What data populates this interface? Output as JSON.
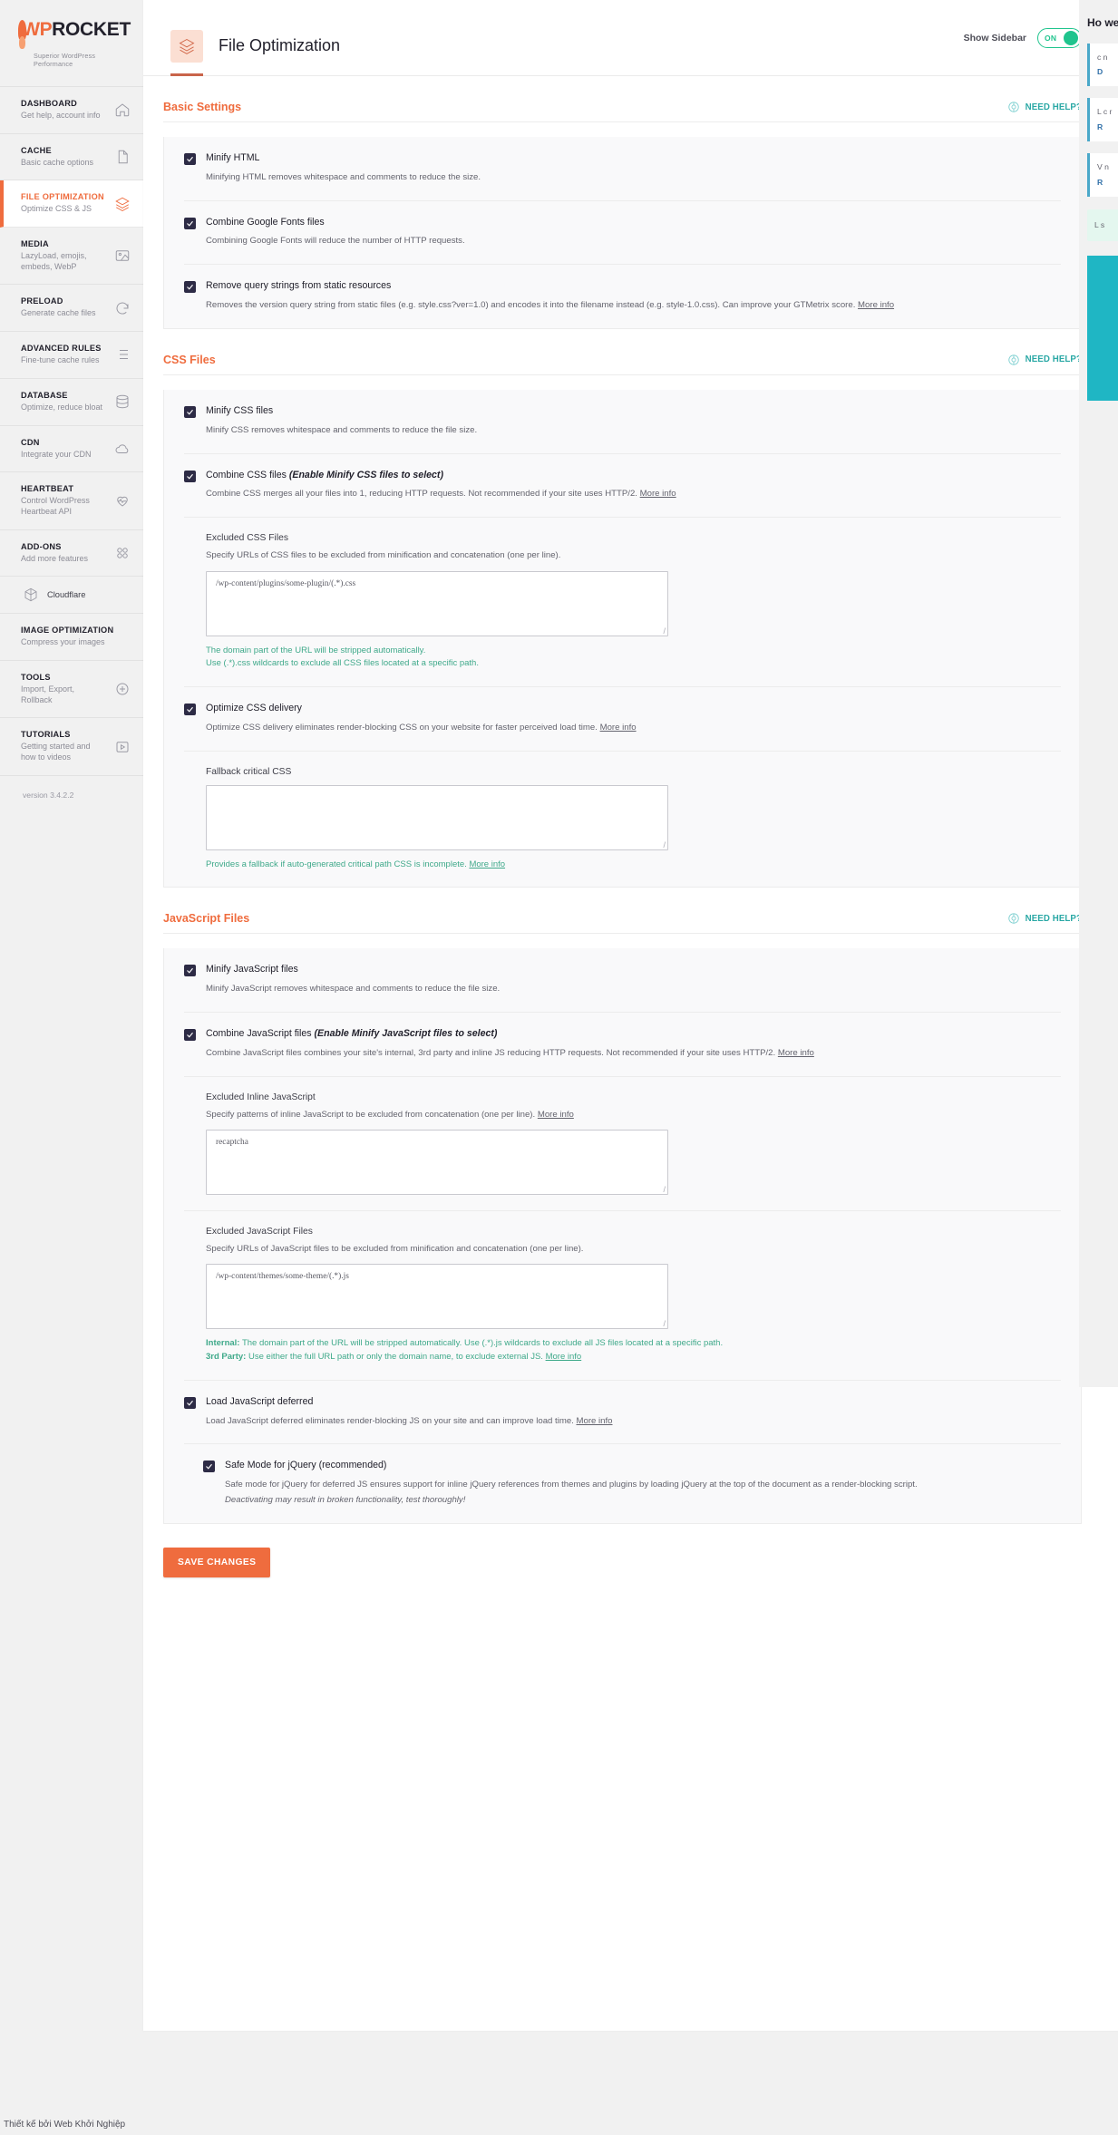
{
  "brand": {
    "name_wp": "WP",
    "name_rocket": "ROCKET",
    "tagline": "Superior WordPress Performance",
    "accent": "#ef6c3e",
    "version": "version 3.4.2.2"
  },
  "sidebar": {
    "items": [
      {
        "title": "DASHBOARD",
        "sub": "Get help, account info",
        "icon": "home-icon",
        "active": false
      },
      {
        "title": "CACHE",
        "sub": "Basic cache options",
        "icon": "document-icon",
        "active": false
      },
      {
        "title": "FILE OPTIMIZATION",
        "sub": "Optimize CSS & JS",
        "icon": "layers-icon",
        "active": true
      },
      {
        "title": "MEDIA",
        "sub": "LazyLoad, emojis, embeds, WebP",
        "icon": "image-icon",
        "active": false
      },
      {
        "title": "PRELOAD",
        "sub": "Generate cache files",
        "icon": "refresh-icon",
        "active": false
      },
      {
        "title": "ADVANCED RULES",
        "sub": "Fine-tune cache rules",
        "icon": "list-icon",
        "active": false
      },
      {
        "title": "DATABASE",
        "sub": "Optimize, reduce bloat",
        "icon": "database-icon",
        "active": false
      },
      {
        "title": "CDN",
        "sub": "Integrate your CDN",
        "icon": "cloud-icon",
        "active": false
      },
      {
        "title": "HEARTBEAT",
        "sub": "Control WordPress Heartbeat API",
        "icon": "heart-icon",
        "active": false
      },
      {
        "title": "ADD-ONS",
        "sub": "Add more features",
        "icon": "addons-icon",
        "active": false
      }
    ],
    "sub_item": {
      "label": "Cloudflare",
      "icon": "cloudflare-icon"
    },
    "items_after": [
      {
        "title": "IMAGE OPTIMIZATION",
        "sub": "Compress your images",
        "icon": "image-opt-icon",
        "active": false
      },
      {
        "title": "TOOLS",
        "sub": "Import, Export, Rollback",
        "icon": "tools-icon",
        "active": false
      },
      {
        "title": "TUTORIALS",
        "sub": "Getting started and how to videos",
        "icon": "video-icon",
        "active": false
      }
    ]
  },
  "topbar": {
    "title": "File Optimization",
    "icon": "layers-icon",
    "show_sidebar_label": "Show Sidebar",
    "toggle_state": "ON",
    "toggle_color": "#1fc48d"
  },
  "need_help_label": "NEED HELP?",
  "sections": [
    {
      "title": "Basic Settings",
      "options": [
        {
          "label": "Minify HTML",
          "checked": true,
          "desc": "Minifying HTML removes whitespace and comments to reduce the size."
        },
        {
          "label": "Combine Google Fonts files",
          "checked": true,
          "desc": "Combining Google Fonts will reduce the number of HTTP requests."
        },
        {
          "label": "Remove query strings from static resources",
          "checked": true,
          "desc": "Removes the version query string from static files (e.g. style.css?ver=1.0) and encodes it into the filename instead (e.g. style-1.0.css). Can improve your GTMetrix score.",
          "more_info": "More info"
        }
      ]
    },
    {
      "title": "CSS Files",
      "options": [
        {
          "label": "Minify CSS files",
          "checked": true,
          "desc": "Minify CSS removes whitespace and comments to reduce the file size."
        },
        {
          "label": "Combine CSS files",
          "label_hint": "(Enable Minify CSS files to select)",
          "checked": true,
          "desc": "Combine CSS merges all your files into 1, reducing HTTP requests. Not recommended if your site uses HTTP/2.",
          "more_info": "More info"
        }
      ],
      "excluded_css": {
        "field_label": "Excluded CSS Files",
        "field_desc": "Specify URLs of CSS files to be excluded from minification and concatenation (one per line).",
        "value": "/wp-content/plugins/some-plugin/(.*).css",
        "note_line1": "The domain part of the URL will be stripped automatically.",
        "note_line2": "Use (.*).css wildcards to exclude all CSS files located at a specific path."
      },
      "optimize_delivery": {
        "label": "Optimize CSS delivery",
        "checked": true,
        "desc": "Optimize CSS delivery eliminates render-blocking CSS on your website for faster perceived load time.",
        "more_info": "More info"
      },
      "fallback": {
        "field_label": "Fallback critical CSS",
        "value": "",
        "note": "Provides a fallback if auto-generated critical path CSS is incomplete.",
        "more_info": "More info"
      }
    },
    {
      "title": "JavaScript Files",
      "options": [
        {
          "label": "Minify JavaScript files",
          "checked": true,
          "desc": "Minify JavaScript removes whitespace and comments to reduce the file size."
        },
        {
          "label": "Combine JavaScript files",
          "label_hint": "(Enable Minify JavaScript files to select)",
          "checked": true,
          "desc": "Combine JavaScript files combines your site's internal, 3rd party and inline JS reducing HTTP requests. Not recommended if your site uses HTTP/2.",
          "more_info": "More info"
        }
      ],
      "excluded_inline": {
        "field_label": "Excluded Inline JavaScript",
        "field_desc": "Specify patterns of inline JavaScript to be excluded from concatenation (one per line).",
        "more_info": "More info",
        "value": "recaptcha"
      },
      "excluded_js": {
        "field_label": "Excluded JavaScript Files",
        "field_desc": "Specify URLs of JavaScript files to be excluded from minification and concatenation (one per line).",
        "value": "/wp-content/themes/some-theme/(.*).js",
        "note_internal_label": "Internal:",
        "note_internal": " The domain part of the URL will be stripped automatically. Use (.*).js wildcards to exclude all JS files located at a specific path.",
        "note_third_label": "3rd Party:",
        "note_third": " Use either the full URL path or only the domain name, to exclude external JS.",
        "more_info": "More info"
      },
      "load_deferred": {
        "label": "Load JavaScript deferred",
        "checked": true,
        "desc": "Load JavaScript deferred eliminates render-blocking JS on your site and can improve load time.",
        "more_info": "More info"
      },
      "safe_mode": {
        "label": "Safe Mode for jQuery (recommended)",
        "checked": true,
        "desc": "Safe mode for jQuery for deferred JS ensures support for inline jQuery references from themes and plugins by loading jQuery at the top of the document as a render-blocking script.",
        "desc_italic": "Deactivating may result in broken functionality, test thoroughly!"
      }
    }
  ],
  "save_label": "SAVE CHANGES",
  "right_panel": {
    "title": "Ho we",
    "cards": [
      {
        "body": "c n",
        "link": "D"
      },
      {
        "body": "L c r",
        "link": "R"
      },
      {
        "body": "V n",
        "link": "R"
      }
    ],
    "green_note": "L s"
  },
  "footer_credit": "Thiết kế bởi Web Khởi Nghiệp"
}
